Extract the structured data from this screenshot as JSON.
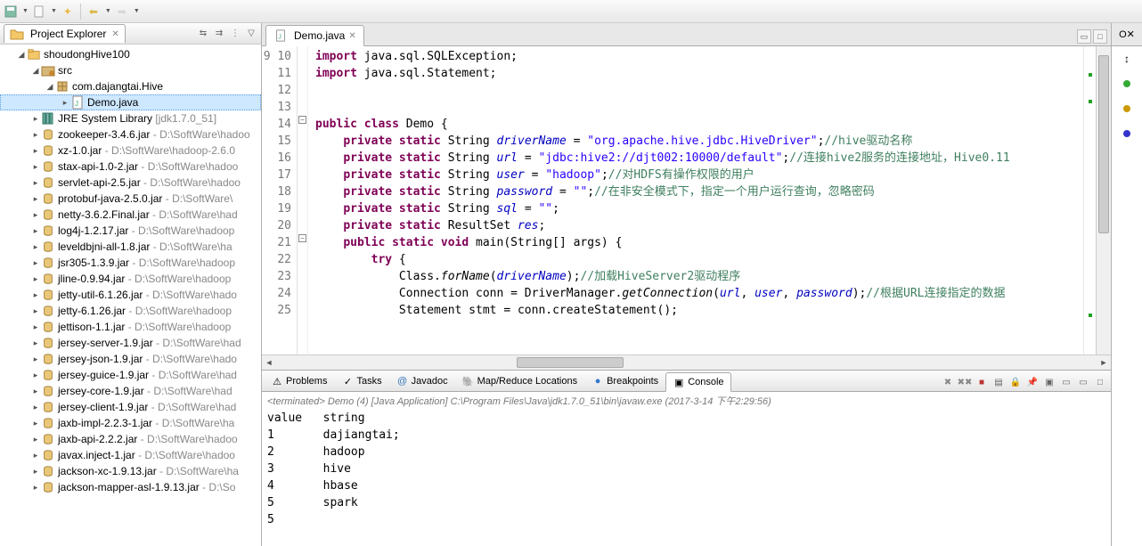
{
  "projectExplorer": {
    "title": "Project Explorer",
    "project": "shoudongHive100",
    "src": "src",
    "package": "com.dajangtai.Hive",
    "file": "Demo.java",
    "jre": "JRE System Library",
    "jreDeco": "[jdk1.7.0_51]",
    "jars": [
      {
        "name": "zookeeper-3.4.6.jar",
        "deco": " - D:\\SoftWare\\hadoo"
      },
      {
        "name": "xz-1.0.jar",
        "deco": " - D:\\SoftWare\\hadoop-2.6.0"
      },
      {
        "name": "stax-api-1.0-2.jar",
        "deco": " - D:\\SoftWare\\hadoo"
      },
      {
        "name": "servlet-api-2.5.jar",
        "deco": " - D:\\SoftWare\\hadoo"
      },
      {
        "name": "protobuf-java-2.5.0.jar",
        "deco": " - D:\\SoftWare\\"
      },
      {
        "name": "netty-3.6.2.Final.jar",
        "deco": " - D:\\SoftWare\\had"
      },
      {
        "name": "log4j-1.2.17.jar",
        "deco": " - D:\\SoftWare\\hadoop"
      },
      {
        "name": "leveldbjni-all-1.8.jar",
        "deco": " - D:\\SoftWare\\ha"
      },
      {
        "name": "jsr305-1.3.9.jar",
        "deco": " - D:\\SoftWare\\hadoop"
      },
      {
        "name": "jline-0.9.94.jar",
        "deco": " - D:\\SoftWare\\hadoop"
      },
      {
        "name": "jetty-util-6.1.26.jar",
        "deco": " - D:\\SoftWare\\hado"
      },
      {
        "name": "jetty-6.1.26.jar",
        "deco": " - D:\\SoftWare\\hadoop"
      },
      {
        "name": "jettison-1.1.jar",
        "deco": " - D:\\SoftWare\\hadoop"
      },
      {
        "name": "jersey-server-1.9.jar",
        "deco": " - D:\\SoftWare\\had"
      },
      {
        "name": "jersey-json-1.9.jar",
        "deco": " - D:\\SoftWare\\hado"
      },
      {
        "name": "jersey-guice-1.9.jar",
        "deco": " - D:\\SoftWare\\had"
      },
      {
        "name": "jersey-core-1.9.jar",
        "deco": " - D:\\SoftWare\\had"
      },
      {
        "name": "jersey-client-1.9.jar",
        "deco": " - D:\\SoftWare\\had"
      },
      {
        "name": "jaxb-impl-2.2.3-1.jar",
        "deco": " - D:\\SoftWare\\ha"
      },
      {
        "name": "jaxb-api-2.2.2.jar",
        "deco": " - D:\\SoftWare\\hadoo"
      },
      {
        "name": "javax.inject-1.jar",
        "deco": " - D:\\SoftWare\\hadoo"
      },
      {
        "name": "jackson-xc-1.9.13.jar",
        "deco": " - D:\\SoftWare\\ha"
      },
      {
        "name": "jackson-mapper-asl-1.9.13.jar",
        "deco": " - D:\\So"
      }
    ]
  },
  "editor": {
    "tabTitle": "Demo.java",
    "lines": [
      9,
      10,
      11,
      12,
      13,
      14,
      15,
      16,
      17,
      18,
      19,
      20,
      21,
      22,
      23,
      24,
      25
    ],
    "code": {
      "l9": "import java.sql.SQLException;",
      "l10": "import java.sql.Statement;",
      "l13_class": "Demo",
      "l14_var": "driverName",
      "l14_val": "\"org.apache.hive.jdbc.HiveDriver\"",
      "l14_cmt": "//hive驱动名称",
      "l15_var": "url",
      "l15_val": "\"jdbc:hive2://djt002:10000/default\"",
      "l15_cmt": "//连接hive2服务的连接地址，Hive0.11",
      "l16_var": "user",
      "l16_val": "\"hadoop\"",
      "l16_cmt": "//对HDFS有操作权限的用户",
      "l17_var": "password",
      "l17_val": "\"\"",
      "l17_cmt": "//在非安全模式下，指定一个用户运行查询，忽略密码",
      "l18_var": "sql",
      "l18_val": "\"\"",
      "l19_var": "res",
      "l20_main": "main",
      "l22_cmt": "//加载HiveServer2驱动程序",
      "l23_cmt": "//根据URL连接指定的数据"
    }
  },
  "bottomTabs": {
    "problems": "Problems",
    "tasks": "Tasks",
    "javadoc": "Javadoc",
    "mapreduce": "Map/Reduce Locations",
    "breakpoints": "Breakpoints",
    "console": "Console"
  },
  "console": {
    "header": "<terminated> Demo (4) [Java Application] C:\\Program Files\\Java\\jdk1.7.0_51\\bin\\javaw.exe (2017-3-14 下午2:29:56)",
    "output": "value   string\n1       dajiangtai;\n2       hadoop\n3       hive\n4       hbase\n5       spark\n5"
  },
  "rightPane": {
    "label": "O"
  }
}
